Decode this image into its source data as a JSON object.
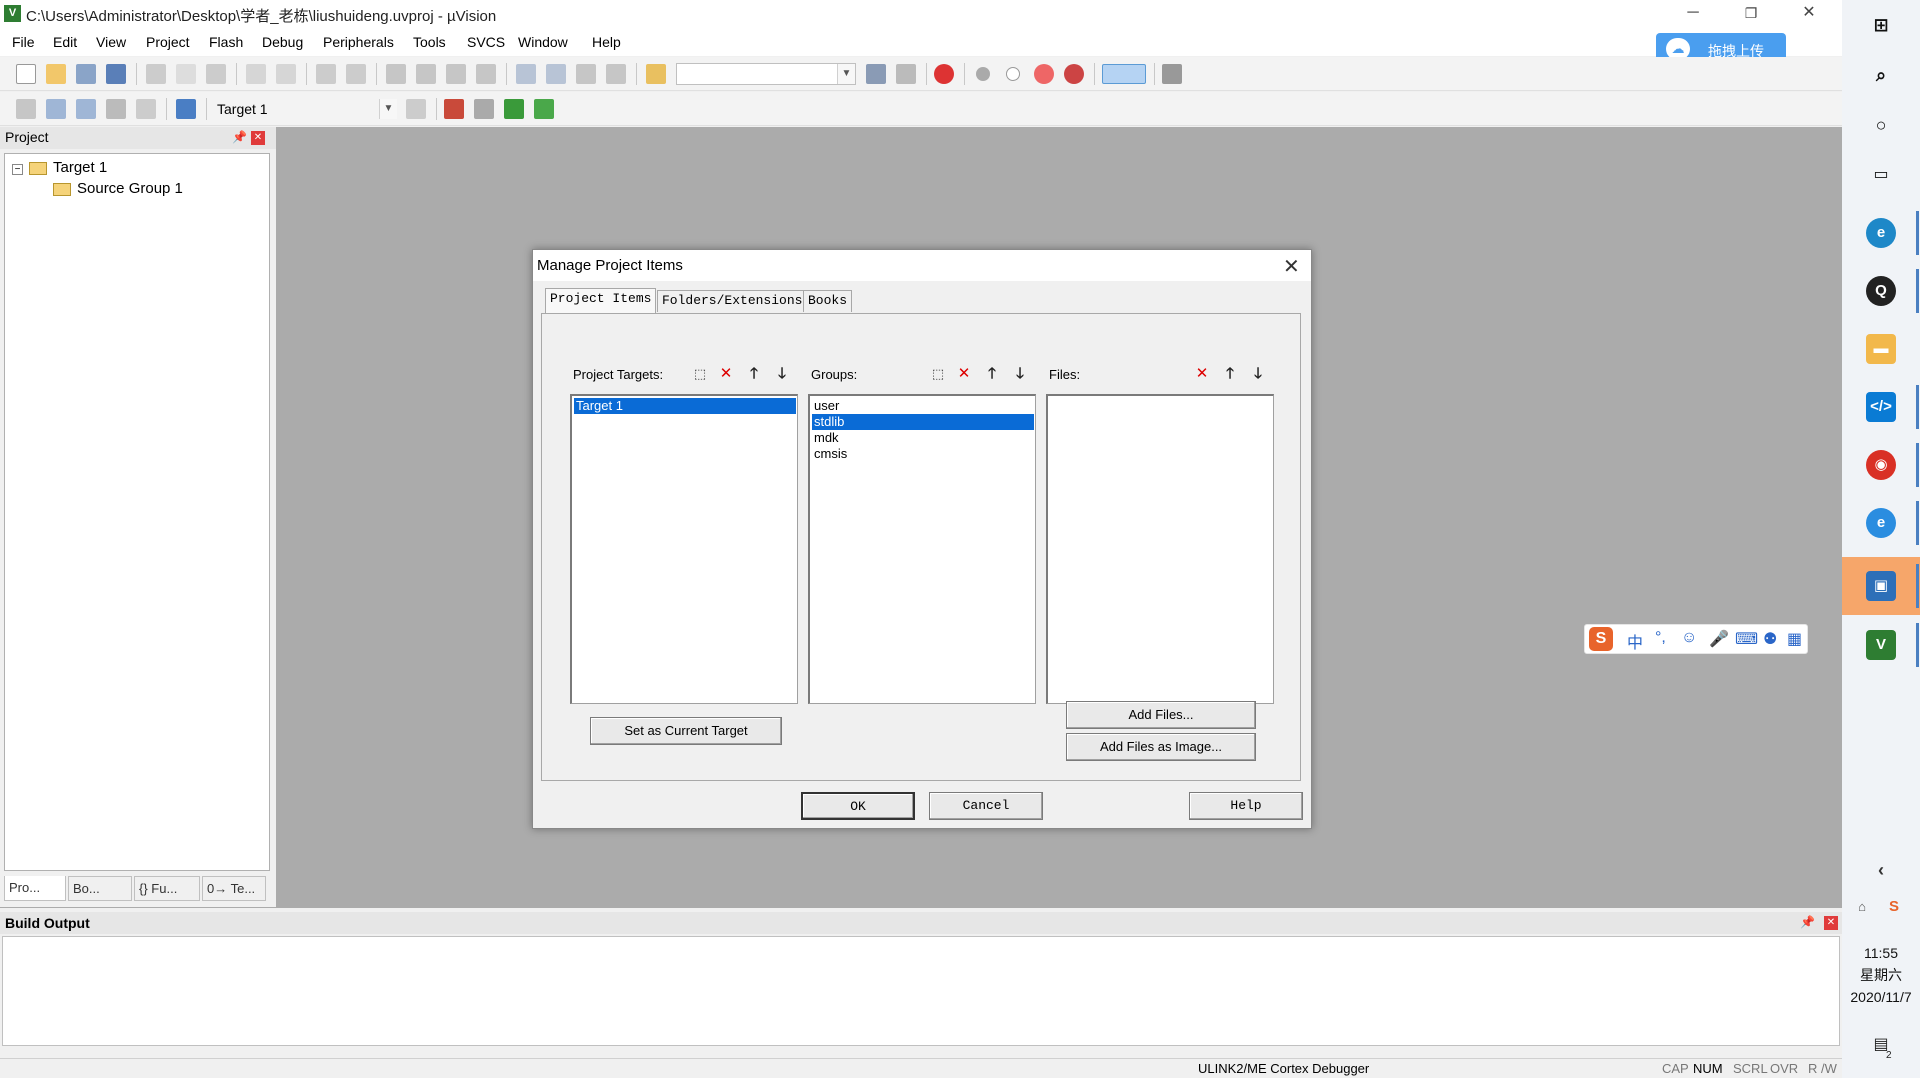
{
  "window": {
    "title": "C:\\Users\\Administrator\\Desktop\\学者_老栋\\liushuideng.uvproj - µVision",
    "app_icon": "V",
    "minimize_icon": "─",
    "restore_icon": "❐",
    "close_icon": "✕"
  },
  "menu": [
    "File",
    "Edit",
    "View",
    "Project",
    "Flash",
    "Debug",
    "Peripherals",
    "Tools",
    "SVCS",
    "Window",
    "Help"
  ],
  "upload_button": {
    "label": "拖拽上传"
  },
  "toolbar2": {
    "target_select": "Target 1"
  },
  "project_panel": {
    "title": "Project",
    "tree": {
      "root": "Target 1",
      "child": "Source Group 1"
    },
    "tabs": [
      "Pro...",
      "Bo...",
      "{} Fu...",
      "0→ Te..."
    ]
  },
  "build_output": {
    "title": "Build Output"
  },
  "status_bar": {
    "debugger": "ULINK2/ME Cortex Debugger",
    "indicators": [
      "CAP",
      "NUM",
      "SCRL",
      "OVR",
      "R /W"
    ]
  },
  "dialog": {
    "title": "Manage Project Items",
    "tabs": [
      "Project Items",
      "Folders/Extensions",
      "Books"
    ],
    "targets": {
      "label": "Project Targets:",
      "items": [
        "Target 1"
      ],
      "selected": 0
    },
    "groups": {
      "label": "Groups:",
      "items": [
        "user",
        "stdlib",
        "mdk",
        "cmsis"
      ],
      "selected": 1
    },
    "files": {
      "label": "Files:",
      "items": []
    },
    "buttons": {
      "set_current": "Set as Current Target",
      "add_files": "Add Files...",
      "add_files_image": "Add Files as Image...",
      "ok": "OK",
      "cancel": "Cancel",
      "help": "Help"
    }
  },
  "ime": {
    "chinese": "中",
    "punct": "°,"
  },
  "taskbar": {
    "time": "11:55",
    "weekday": "星期六",
    "date": "2020/11/7",
    "notification_count": "2"
  },
  "colors": {
    "selection": "#0a6bd6",
    "workspace": "#ababab",
    "delete_red": "#dd0000",
    "upload_blue": "#4a9eef"
  }
}
